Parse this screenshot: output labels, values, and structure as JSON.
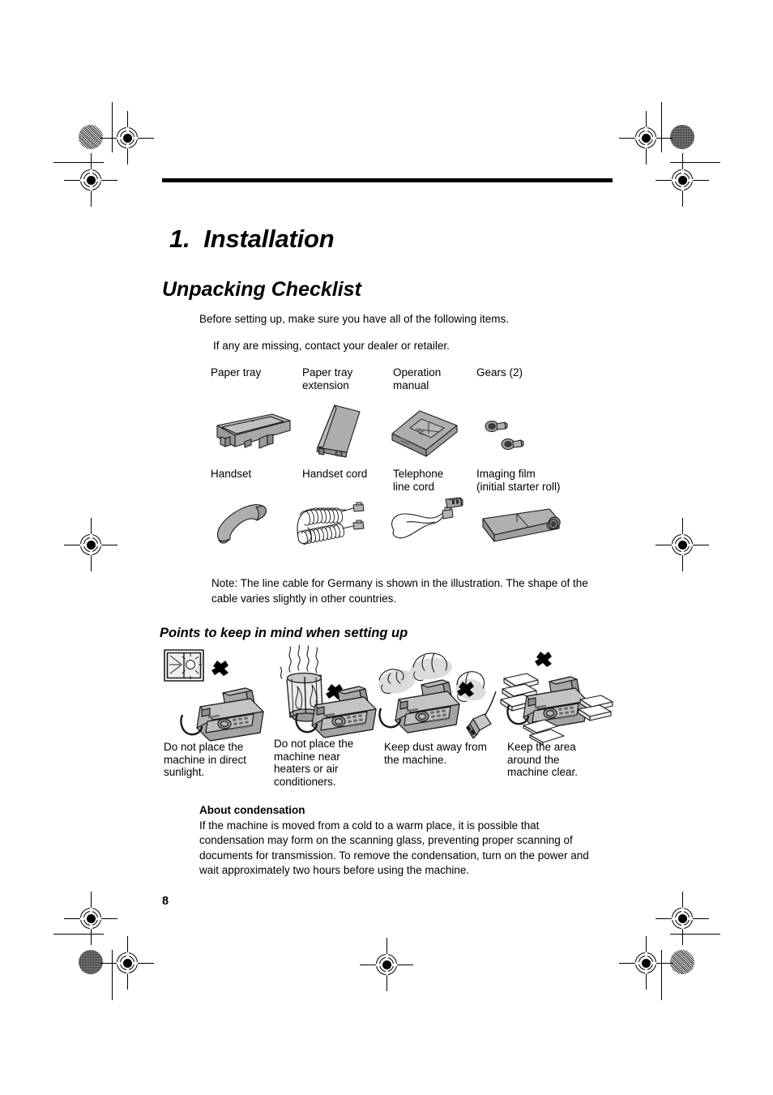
{
  "document": {
    "chapter_number": "1.",
    "chapter_title": "Installation",
    "section_title": "Unpacking Checklist",
    "intro_line_1": "Before setting up, make sure you have all of the following items.",
    "intro_line_2": "If any are missing, contact your dealer or retailer.",
    "note": "Note: The line cable for Germany is shown in the illustration. The shape of the cable varies slightly in other countries.",
    "page_number": "8"
  },
  "checklist": {
    "row1": [
      {
        "label": "Paper tray",
        "icon": "paper-tray-icon"
      },
      {
        "label": "Paper tray\nextension",
        "icon": "paper-tray-extension-icon"
      },
      {
        "label": "Operation\nmanual",
        "icon": "operation-manual-icon"
      },
      {
        "label": "Gears (2)",
        "icon": "gears-icon"
      }
    ],
    "row2": [
      {
        "label": "Handset",
        "icon": "handset-icon"
      },
      {
        "label": "Handset cord",
        "icon": "handset-cord-icon"
      },
      {
        "label": "Telephone\nline cord",
        "icon": "telephone-line-cord-icon"
      },
      {
        "label": "Imaging film\n(initial starter roll)",
        "icon": "imaging-film-icon"
      }
    ]
  },
  "points": {
    "title": "Points to keep in mind when setting up",
    "items": [
      {
        "caption": "Do not place the\nmachine in direct\nsunlight.",
        "icon": "window-sunlight-icon"
      },
      {
        "caption": "Do not place the\nmachine near\nheaters or air\nconditioners.",
        "icon": "heater-icon"
      },
      {
        "caption": "Keep dust away from\nthe machine.",
        "icon": "dust-icon"
      },
      {
        "caption": "Keep the area\naround the\nmachine clear.",
        "icon": "stacked-paper-icon"
      }
    ]
  },
  "condensation": {
    "heading": "About condensation",
    "body": "If the machine is moved from a cold to a warm place, it is possible that condensation may form on the scanning glass, preventing proper scanning of documents for transmission. To remove the condensation, turn on the power and wait approximately two hours before using the machine."
  },
  "colors": {
    "illustration_fill": "#a8a8a8",
    "illustration_fill_light": "#c4c4c4",
    "illustration_fill_dark": "#8e8e8e",
    "outline": "#1a1a1a",
    "text": "#000000"
  }
}
